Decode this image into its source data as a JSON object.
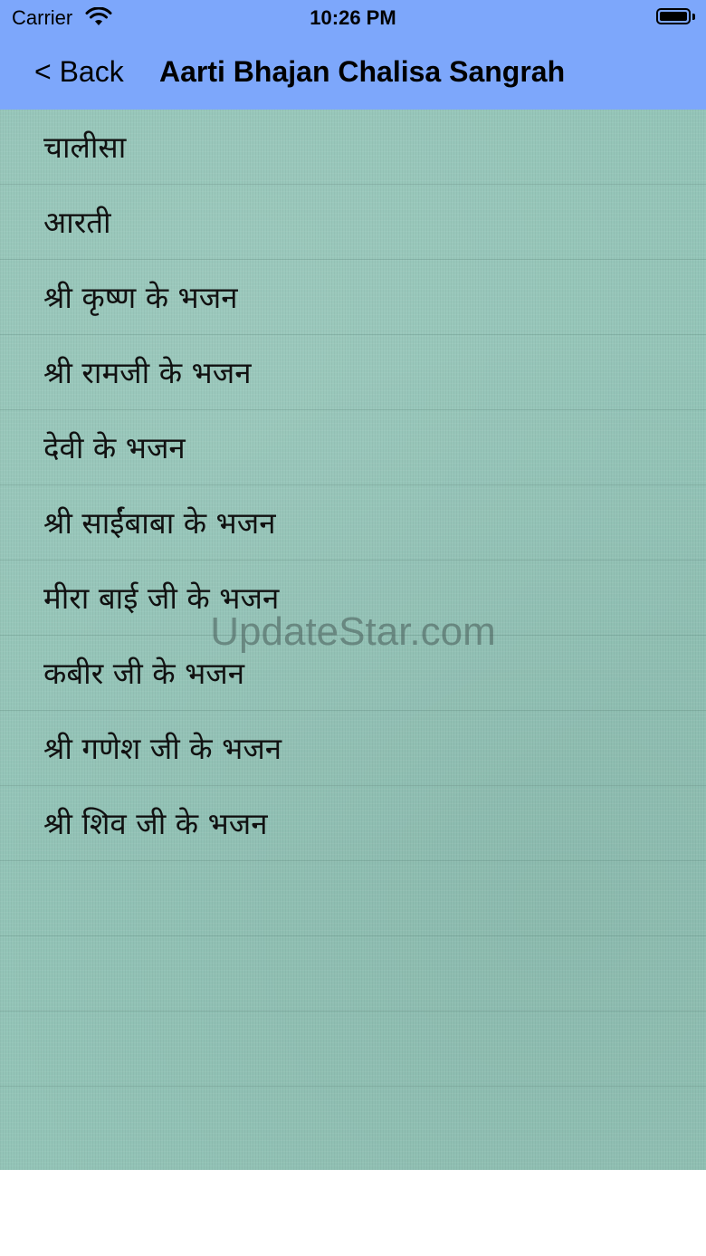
{
  "status_bar": {
    "carrier": "Carrier",
    "time": "10:26 PM"
  },
  "nav": {
    "back_label": "< Back",
    "title": "Aarti Bhajan Chalisa Sangrah"
  },
  "list": {
    "items": [
      {
        "label": "चालीसा"
      },
      {
        "label": "आरती"
      },
      {
        "label": "श्री कृष्ण के भजन"
      },
      {
        "label": "श्री रामजी के भजन"
      },
      {
        "label": "देवी के भजन"
      },
      {
        "label": "श्री साईंबाबा के भजन"
      },
      {
        "label": "मीरा बाई जी के भजन"
      },
      {
        "label": "कबीर जी के भजन"
      },
      {
        "label": "श्री गणेश जी के भजन"
      },
      {
        "label": "श्री शिव जी के भजन"
      }
    ]
  },
  "watermark": "UpdateStar.com",
  "colors": {
    "nav_background": "#7da7fb",
    "list_background": "#93c4b7",
    "text": "#111111"
  },
  "icons": [
    "wifi-icon",
    "battery-icon"
  ]
}
